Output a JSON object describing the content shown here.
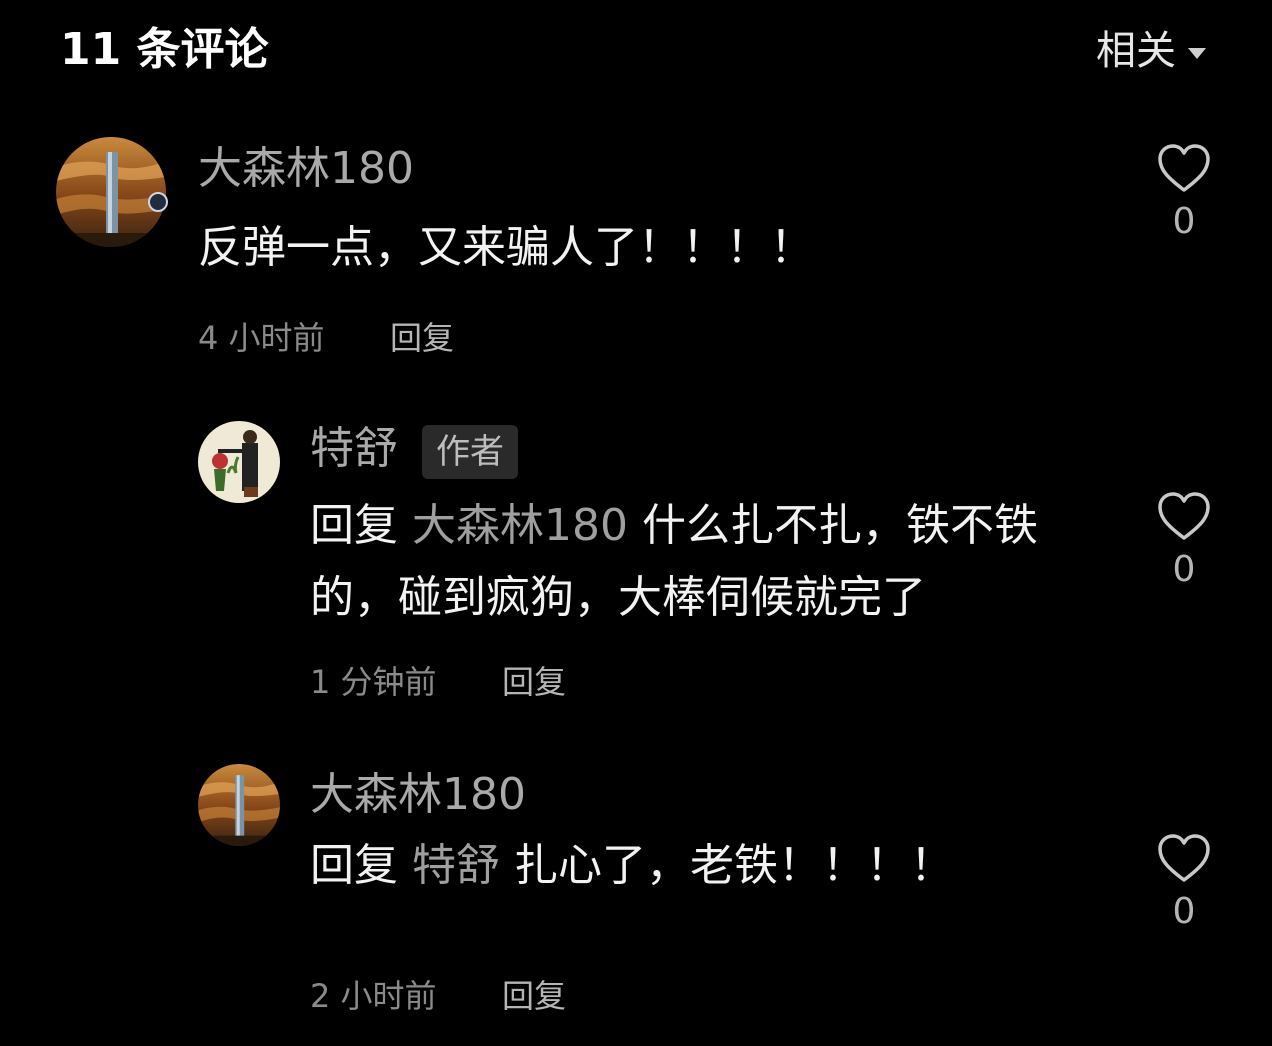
{
  "header": {
    "title": "11 条评论",
    "sort_label": "相关"
  },
  "comments": [
    {
      "username": "大森林180",
      "text": "反弹一点，又来骗人了！！！！",
      "time": "4 小时前",
      "reply_label": "回复",
      "likes": "0",
      "avatar_icon": "canyon-landscape-avatar"
    },
    {
      "username": "特舒",
      "author_tag": "作者",
      "reply_prefix": "回复",
      "mention": "大森林180",
      "text_line1": "什么扎不扎，铁不铁",
      "text_line2": "的，碰到疯狗，大棒伺候就完了",
      "time": "1 分钟前",
      "reply_label": "回复",
      "likes": "0",
      "avatar_icon": "cartoon-figures-avatar"
    },
    {
      "username": "大森林180",
      "reply_prefix": "回复",
      "mention": "特舒",
      "text": "扎心了，老铁！！！！",
      "time": "2 小时前",
      "reply_label": "回复",
      "likes": "0",
      "avatar_icon": "canyon-landscape-avatar"
    }
  ],
  "colors": {
    "background": "#000000",
    "primary_text": "#f2f2f2",
    "secondary_text": "#a9a9a9",
    "meta_text": "#8a8a8a",
    "tag_background": "#2a2a2a"
  }
}
